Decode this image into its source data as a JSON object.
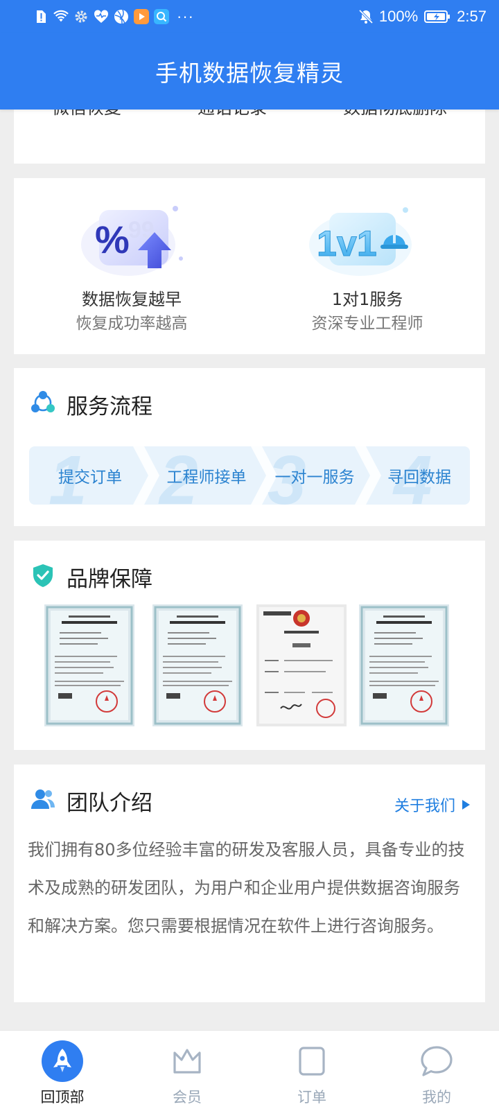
{
  "status_bar": {
    "battery": "100%",
    "time": "2:57"
  },
  "header": {
    "title": "手机数据恢复精灵"
  },
  "top_card": {
    "items": [
      "微信恢复",
      "通话记录",
      "数据彻底删除"
    ]
  },
  "features": [
    {
      "line1": "数据恢复越早",
      "line2": "恢复成功率越高",
      "icon": "percent-arrow-icon",
      "badge": "%"
    },
    {
      "line1": "1对1服务",
      "line2": "资深专业工程师",
      "icon": "one-v-one-engineer-icon",
      "badge": "1v1"
    }
  ],
  "process": {
    "title": "服务流程",
    "steps": [
      {
        "num": "1",
        "label": "提交订单"
      },
      {
        "num": "2",
        "label": "工程师接单"
      },
      {
        "num": "3",
        "label": "一对一服务"
      },
      {
        "num": "4",
        "label": "寻回数据"
      }
    ]
  },
  "brand": {
    "title": "品牌保障",
    "certificates": [
      "software-copyright-certificate",
      "software-copyright-certificate",
      "trademark-registration-certificate",
      "software-copyright-certificate"
    ]
  },
  "team": {
    "title": "团队介绍",
    "about_link": "关于我们",
    "text": "我们拥有80多位经验丰富的研发及客服人员，具备专业的技术及成熟的研发团队，为用户和企业用户提供数据咨询服务和解决方案。您只需要根据情况在软件上进行咨询服务。"
  },
  "bottom_nav": [
    {
      "label": "回顶部",
      "icon": "rocket-icon",
      "active": true
    },
    {
      "label": "会员",
      "icon": "crown-icon",
      "active": false
    },
    {
      "label": "订单",
      "icon": "order-icon",
      "active": false
    },
    {
      "label": "我的",
      "icon": "chat-bubble-icon",
      "active": false
    }
  ],
  "colors": {
    "primary": "#2f7ef1",
    "link": "#1f7ee0",
    "flow_text": "#2b83d0",
    "page_bg": "#eeeeee"
  }
}
